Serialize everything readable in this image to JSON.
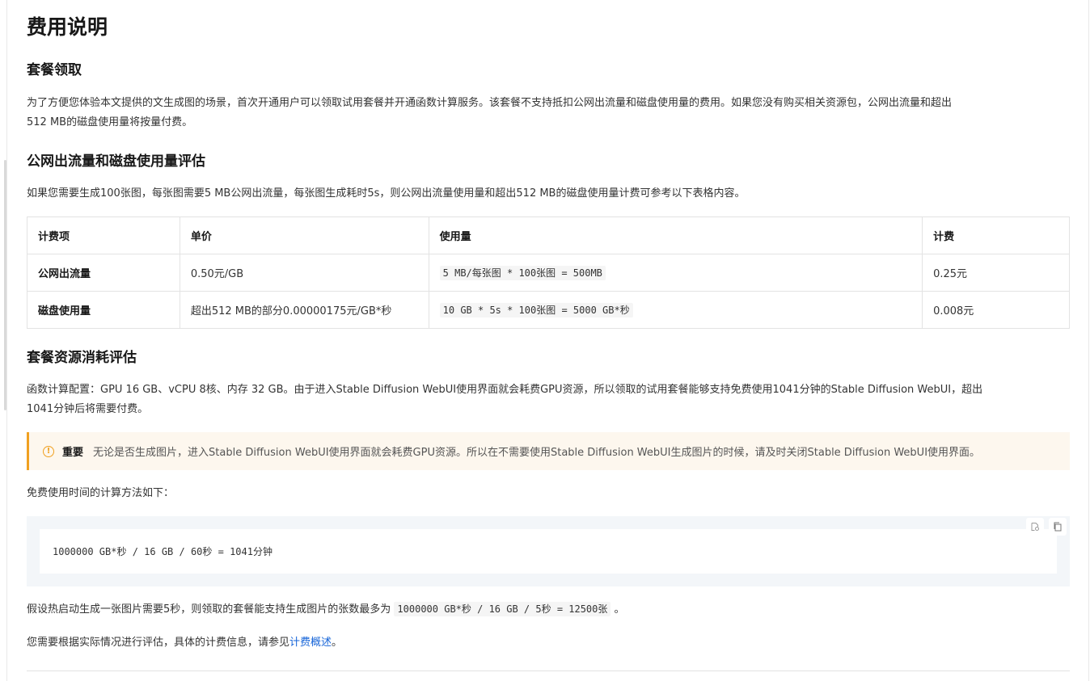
{
  "title": "费用说明",
  "section1": {
    "heading": "套餐领取",
    "para_line1": "为了方便您体验本文提供的文生成图的场景，首次开通用户可以领取试用套餐并开通函数计算服务。该套餐不支持抵扣公网出流量和磁盘使用量的费用。如果您没有购买相关资源包，公网出流量和超出",
    "para_line2": "512 MB的磁盘使用量将按量付费。"
  },
  "section2": {
    "heading": "公网出流量和磁盘使用量评估",
    "para": "如果您需要生成100张图，每张图需要5 MB公网出流量，每张图生成耗时5s，则公网出流量使用量和超出512 MB的磁盘使用量计费可参考以下表格内容。",
    "table": {
      "headers": [
        "计费项",
        "单价",
        "使用量",
        "计费"
      ],
      "rows": [
        {
          "item": "公网出流量",
          "price": "0.50元/GB",
          "usage": "5 MB/每张图 * 100张图 = 500MB",
          "fee": "0.25元"
        },
        {
          "item": "磁盘使用量",
          "price": "超出512 MB的部分0.00000175元/GB*秒",
          "usage": "10 GB * 5s * 100张图 = 5000 GB*秒",
          "fee": "0.008元"
        }
      ]
    }
  },
  "section3": {
    "heading": "套餐资源消耗评估",
    "para_line1": "函数计算配置：GPU 16 GB、vCPU 8核、内存 32 GB。由于进入Stable Diffusion WebUI使用界面就会耗费GPU资源，所以领取的试用套餐能够支持免费使用1041分钟的Stable Diffusion WebUI，超出",
    "para_line2": "1041分钟后将需要付费。",
    "note": {
      "icon": "warning-icon",
      "title": "重要",
      "body": "无论是否生成图片，进入Stable Diffusion WebUI使用界面就会耗费GPU资源。所以在不需要使用Stable Diffusion WebUI生成图片的时候，请及时关闭Stable Diffusion WebUI使用界面。"
    },
    "calc_intro": "免费使用时间的计算方法如下：",
    "code": "1000000 GB*秒 / 16 GB / 60秒 = 1041分钟",
    "assume_prefix": "假设热启动生成一张图片需要5秒，则领取的套餐能支持生成图片的张数最多为",
    "assume_code": "1000000 GB*秒 / 16 GB / 5秒 = 12500张",
    "assume_suffix": "。",
    "closing_prefix": "您需要根据实际情况进行评估，具体的计费信息，请参见",
    "closing_link": "计费概述",
    "closing_suffix": "。"
  },
  "code_tools": {
    "run_icon": "open-in-editor-icon",
    "copy_icon": "copy-icon"
  },
  "colors": {
    "link": "#1765d8",
    "note_border": "#f0a020",
    "note_bg": "#fdf7ee",
    "code_bg": "#f3f6f9"
  }
}
